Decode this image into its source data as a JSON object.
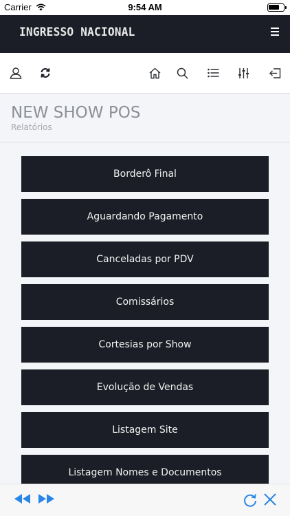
{
  "status_bar": {
    "carrier": "Carrier",
    "time": "9:54 AM",
    "battery_level": 0.75
  },
  "header": {
    "logo_text": "INGRESSO NACIONAL",
    "menu_icon": "hamburger-icon"
  },
  "toolbar": {
    "left_icons": [
      "user-icon",
      "refresh-icon"
    ],
    "right_icons": [
      "home-icon",
      "search-icon",
      "list-icon",
      "sliders-icon",
      "logout-icon"
    ]
  },
  "page": {
    "title": "NEW SHOW POS",
    "subtitle": "Relatórios"
  },
  "reports": [
    {
      "label": "Borderô Final"
    },
    {
      "label": "Aguardando Pagamento"
    },
    {
      "label": "Canceladas por PDV"
    },
    {
      "label": "Comissários"
    },
    {
      "label": "Cortesias por Show"
    },
    {
      "label": "Evolução de Vendas"
    },
    {
      "label": "Listagem Site"
    },
    {
      "label": "Listagem Nomes e Documentos"
    }
  ],
  "bottom_bar": {
    "icons": [
      "rewind-icon",
      "fast-forward-icon",
      "reload-icon",
      "close-icon"
    ],
    "accent_color": "#2a86e6"
  },
  "colors": {
    "header_bg": "#1b1e26",
    "button_bg": "#1b1e26",
    "page_bg": "#f4f5f9"
  }
}
